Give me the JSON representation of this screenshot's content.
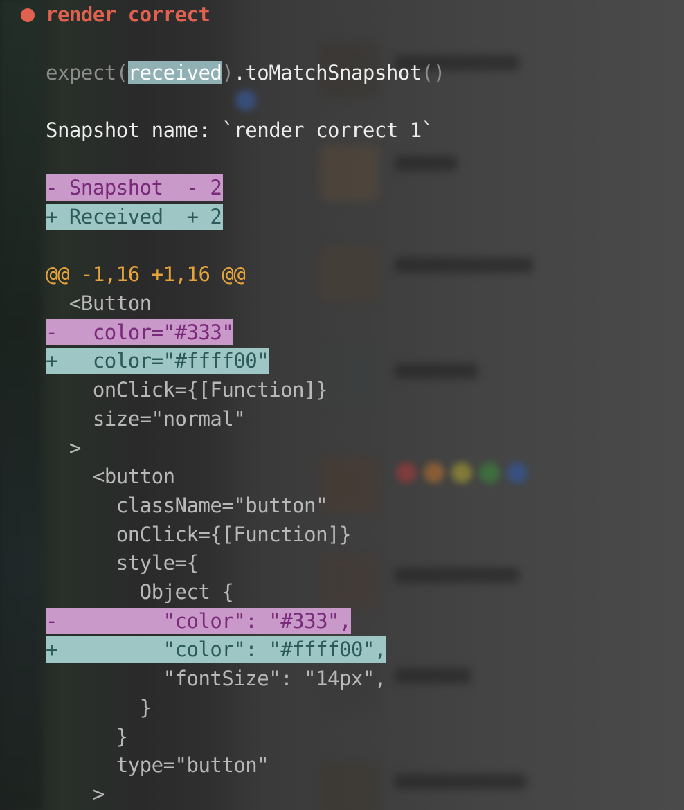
{
  "test": {
    "status_icon": "red-dot",
    "title": "render correct"
  },
  "assertion": {
    "expect_prefix": "expect(",
    "received": "received",
    "expect_suffix_paren": ")",
    "matcher": ".toMatchSnapshot",
    "matcher_parens": "()"
  },
  "snapshot_name_line": "Snapshot name: `render correct 1`",
  "legend": {
    "snapshot": "- Snapshot  - 2",
    "received": "+ Received  + 2"
  },
  "hunk_header": "@@ -1,16 +1,16 @@",
  "diff_lines": [
    {
      "type": "context",
      "text": "  <Button"
    },
    {
      "type": "minus",
      "text": "-   color=\"#333\""
    },
    {
      "type": "plus",
      "text": "+   color=\"#ffff00\""
    },
    {
      "type": "context",
      "text": "    onClick={[Function]}"
    },
    {
      "type": "context",
      "text": "    size=\"normal\""
    },
    {
      "type": "context",
      "text": "  >"
    },
    {
      "type": "context",
      "text": "    <button"
    },
    {
      "type": "context",
      "text": "      className=\"button\""
    },
    {
      "type": "context",
      "text": "      onClick={[Function]}"
    },
    {
      "type": "context",
      "text": "      style={"
    },
    {
      "type": "context",
      "text": "        Object {"
    },
    {
      "type": "minus",
      "text": "-         \"color\": \"#333\","
    },
    {
      "type": "plus",
      "text": "+         \"color\": \"#ffff00\","
    },
    {
      "type": "context",
      "text": "          \"fontSize\": \"14px\","
    },
    {
      "type": "context",
      "text": "        }"
    },
    {
      "type": "context",
      "text": "      }"
    },
    {
      "type": "context",
      "text": "      type=\"button\""
    },
    {
      "type": "context",
      "text": "    >"
    }
  ],
  "colors": {
    "fail_red": "#e0614f",
    "hunk_orange": "#e6a33a",
    "minus_bg": "#c99ac9",
    "minus_fg": "#7a2a7a",
    "plus_bg": "#9ec6c4",
    "plus_fg": "#2c5a5a",
    "received_highlight": "#8fb1b4"
  }
}
